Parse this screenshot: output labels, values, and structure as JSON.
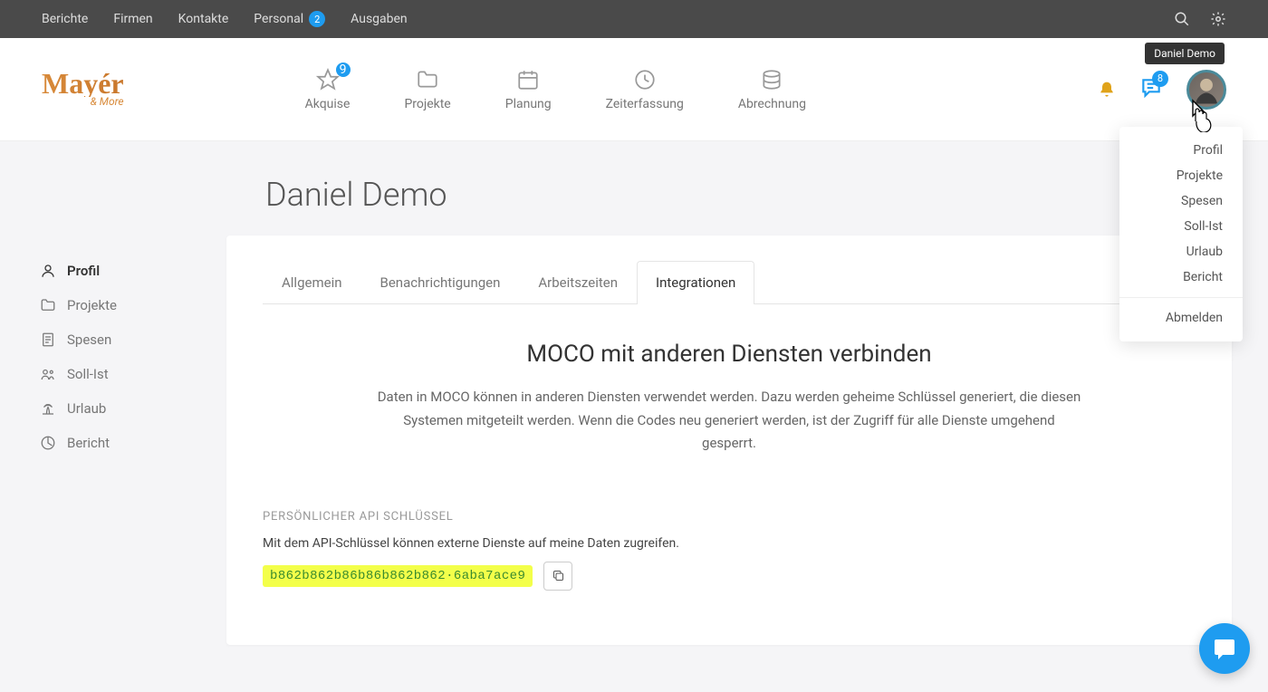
{
  "topbar": {
    "items": [
      {
        "label": "Berichte"
      },
      {
        "label": "Firmen"
      },
      {
        "label": "Kontakte"
      },
      {
        "label": "Personal",
        "badge": "2"
      },
      {
        "label": "Ausgaben"
      }
    ]
  },
  "mainnav": {
    "logo_main": "Mayér",
    "logo_sub": "& More",
    "items": [
      {
        "label": "Akquise",
        "badge": "9"
      },
      {
        "label": "Projekte"
      },
      {
        "label": "Planung"
      },
      {
        "label": "Zeiterfassung"
      },
      {
        "label": "Abrechnung"
      }
    ],
    "chat_badge": "8"
  },
  "tooltip": "Daniel Demo",
  "dropdown": {
    "items": [
      "Profil",
      "Projekte",
      "Spesen",
      "Soll-Ist",
      "Urlaub",
      "Bericht"
    ],
    "logout": "Abmelden"
  },
  "page": {
    "title": "Daniel Demo"
  },
  "sidebar": {
    "items": [
      {
        "label": "Profil",
        "active": true
      },
      {
        "label": "Projekte"
      },
      {
        "label": "Spesen"
      },
      {
        "label": "Soll-Ist"
      },
      {
        "label": "Urlaub"
      },
      {
        "label": "Bericht"
      }
    ]
  },
  "tabs": {
    "items": [
      "Allgemein",
      "Benachrichtigungen",
      "Arbeitszeiten",
      "Integrationen"
    ],
    "active": 3
  },
  "integrations": {
    "heading": "MOCO mit anderen Diensten verbinden",
    "description": "Daten in MOCO können in anderen Diensten verwendet werden. Dazu werden geheime Schlüssel generiert, die diesen Systemen mitgeteilt werden. Wenn die Codes neu generiert werden, ist der Zugriff für alle Dienste umgehend gesperrt.",
    "section_label": "PERSÖNLICHER API SCHLÜSSEL",
    "section_desc": "Mit dem API-Schlüssel können externe Dienste auf meine Daten zugreifen.",
    "api_key": "b862b862b86b86b862b862·6aba7ace9"
  }
}
